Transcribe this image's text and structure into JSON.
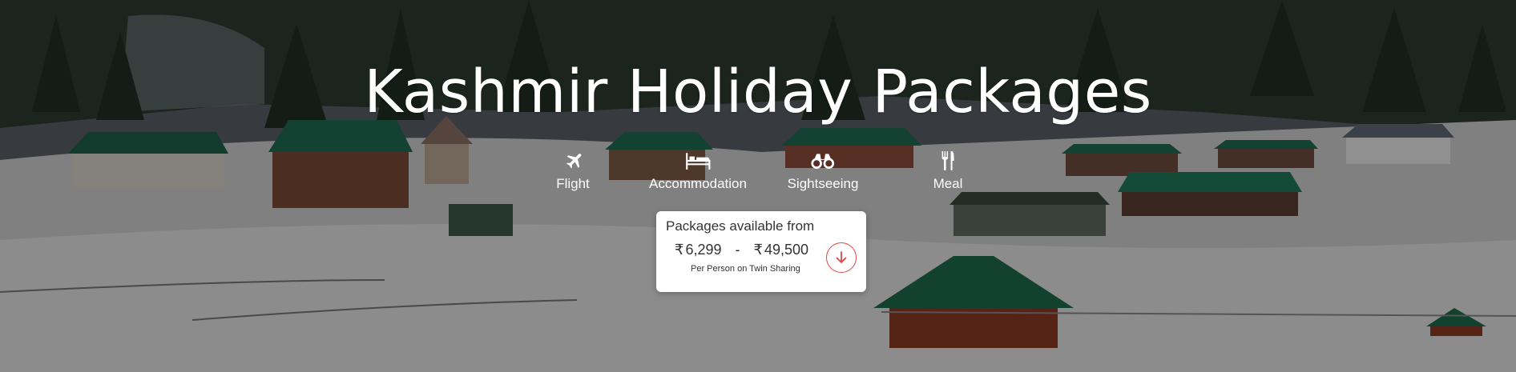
{
  "hero": {
    "title": "Kashmir Holiday Packages"
  },
  "features": [
    {
      "label": "Flight",
      "icon": "plane-icon"
    },
    {
      "label": "Accommodation",
      "icon": "bed-icon"
    },
    {
      "label": "Sightseeing",
      "icon": "binoculars-icon"
    },
    {
      "label": "Meal",
      "icon": "fork-knife-icon"
    }
  ],
  "price_card": {
    "heading": "Packages available from",
    "currency_symbol": "₹",
    "min_price": "6,299",
    "separator": "-",
    "max_price": "49,500",
    "note": "Per Person on Twin Sharing",
    "action_icon": "arrow-down-circle-icon"
  },
  "colors": {
    "accent": "#e04646",
    "text_light": "#ffffff",
    "text_dark": "#333333"
  }
}
